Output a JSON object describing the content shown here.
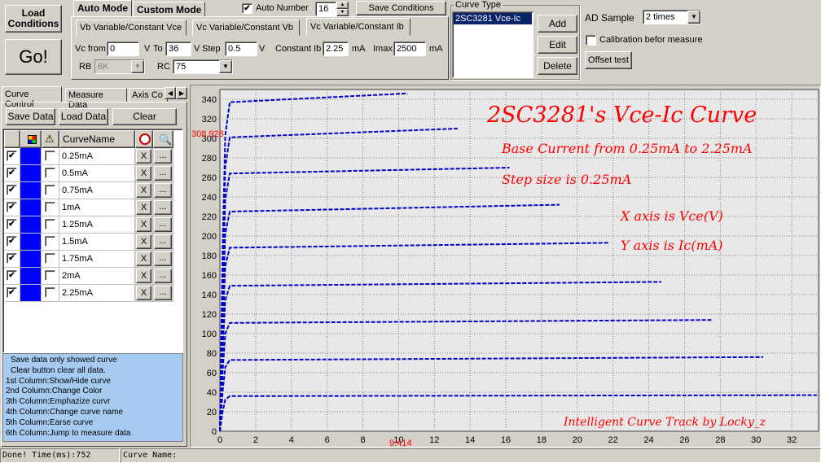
{
  "toolbar": {
    "load_conditions": "Load\nConditions",
    "go": "Go!"
  },
  "mode_tabs": [
    "Auto Mode",
    "Custom Mode"
  ],
  "auto_number": {
    "label": "Auto Number",
    "checked": true,
    "value": "16"
  },
  "save_conditions": "Save Conditions",
  "sub_tabs": [
    "Vb Variable/Constant Vce",
    "Vc Variable/Constant Vb",
    "Vc Variable/Constant Ib"
  ],
  "params": {
    "vc_from_label": "Vc from",
    "vc_from": "0",
    "v1": "V",
    "to_label": "To",
    "to": "36",
    "v2": "V",
    "step_label": "Step",
    "step": "0.5",
    "v3": "V",
    "const_ib_label": "Constant Ib",
    "const_ib": "2.25",
    "ma1": "mA",
    "imax_label": "Imax",
    "imax": "2500",
    "ma2": "mA",
    "rb_label": "RB",
    "rb": "6K",
    "rc_label": "RC",
    "rc": "75"
  },
  "curve_type": {
    "legend": "Curve Type",
    "items": [
      "2SC3281 Vce-Ic"
    ],
    "add": "Add",
    "edit": "Edit",
    "delete": "Delete"
  },
  "ad": {
    "sample_label": "AD Sample",
    "sample_value": "2 times",
    "calibration": "Calibration befor measure",
    "offset_test": "Offset test"
  },
  "left_tabs": [
    "Curve Control",
    "Measure Data",
    "Axis Co"
  ],
  "left_buttons": {
    "save": "Save Data",
    "load": "Load Data",
    "clear": "Clear"
  },
  "grid": {
    "header_name": "CurveName",
    "rows": [
      {
        "name": "0.25mA",
        "checked": true,
        "x": "X",
        "dots": "..."
      },
      {
        "name": "0.5mA",
        "checked": true,
        "x": "X",
        "dots": "..."
      },
      {
        "name": "0.75mA",
        "checked": true,
        "x": "X",
        "dots": "..."
      },
      {
        "name": "1mA",
        "checked": true,
        "x": "X",
        "dots": "..."
      },
      {
        "name": "1.25mA",
        "checked": true,
        "x": "X",
        "dots": "..."
      },
      {
        "name": "1.5mA",
        "checked": true,
        "x": "X",
        "dots": "..."
      },
      {
        "name": "1.75mA",
        "checked": true,
        "x": "X",
        "dots": "..."
      },
      {
        "name": "2mA",
        "checked": true,
        "x": "X",
        "dots": "..."
      },
      {
        "name": "2.25mA",
        "checked": true,
        "x": "X",
        "dots": "..."
      }
    ]
  },
  "help_lines": [
    "Save data only showed curve",
    "Clear button clear all data.",
    "1st Column:Show/Hide curve",
    "2nd Column:Change Color",
    "3th Column:Emphazize curvr",
    "4th Column:Change curve name",
    "5th Column:Earse curve",
    "6th Column:Jump to measure data"
  ],
  "status": {
    "left": "Done!  Time(ms):752",
    "right": "Curve Name:"
  },
  "colors": {
    "curve": "#0000cc",
    "annotation": "#ff0000",
    "grid_bg": "#e8e8e8",
    "row_color": "#0000ff"
  },
  "chart_data": {
    "type": "line",
    "title": "2SC3281's Vce-Ic Curve",
    "annotations": [
      "Base Current from 0.25mA to 2.25mA",
      "Step size is 0.25mA",
      "X axis is Vce(V)",
      "Y axis is Ic(mA)",
      "Intelligent Curve Track by Locky_z"
    ],
    "cursor_y_label": "308.928",
    "cursor_x_label": "9.414",
    "xlim": [
      0,
      33.5
    ],
    "ylim": [
      0,
      350
    ],
    "x_ticks": [
      0,
      2,
      4,
      6,
      8,
      10,
      12,
      14,
      16,
      18,
      20,
      22,
      24,
      26,
      28,
      30,
      32
    ],
    "y_ticks": [
      0,
      20,
      40,
      60,
      80,
      100,
      120,
      140,
      160,
      180,
      200,
      220,
      240,
      260,
      280,
      300,
      320,
      340
    ],
    "grid": true,
    "series": [
      {
        "name": "2.25mA",
        "x_end": 10.5,
        "y_sat": 337,
        "y_end": 346
      },
      {
        "name": "2mA",
        "x_end": 13.3,
        "y_sat": 301,
        "y_end": 310
      },
      {
        "name": "1.75mA",
        "x_end": 16.2,
        "y_sat": 264,
        "y_end": 270
      },
      {
        "name": "1.5mA",
        "x_end": 19.0,
        "y_sat": 225,
        "y_end": 232
      },
      {
        "name": "1.25mA",
        "x_end": 21.8,
        "y_sat": 188,
        "y_end": 193
      },
      {
        "name": "1mA",
        "x_end": 24.7,
        "y_sat": 149,
        "y_end": 153
      },
      {
        "name": "0.75mA",
        "x_end": 27.5,
        "y_sat": 111,
        "y_end": 114
      },
      {
        "name": "0.5mA",
        "x_end": 30.4,
        "y_sat": 73,
        "y_end": 76
      },
      {
        "name": "0.25mA",
        "x_end": 33.4,
        "y_sat": 36,
        "y_end": 37
      }
    ]
  }
}
